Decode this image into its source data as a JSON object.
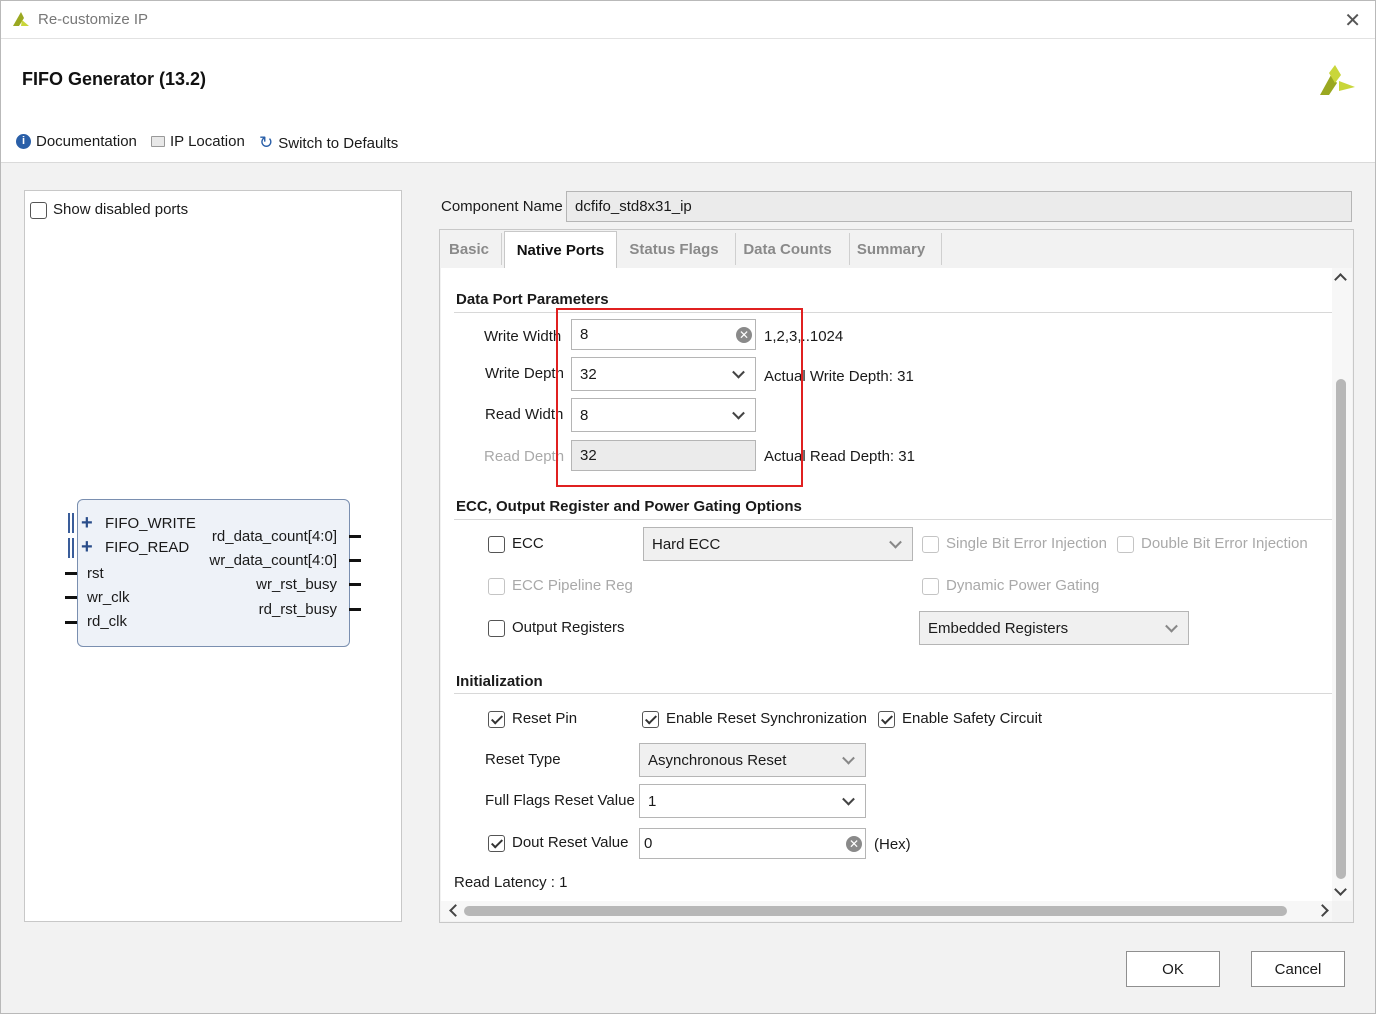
{
  "window": {
    "title": "Re-customize IP"
  },
  "header": {
    "title": "FIFO Generator (13.2)"
  },
  "toolbar": {
    "documentation": "Documentation",
    "ip_location": "IP Location",
    "switch_defaults": "Switch to Defaults"
  },
  "left": {
    "show_disabled_ports": "Show disabled ports",
    "block": {
      "left_ports": [
        "FIFO_WRITE",
        "FIFO_READ",
        "rst",
        "wr_clk",
        "rd_clk"
      ],
      "right_ports": [
        "rd_data_count[4:0]",
        "wr_data_count[4:0]",
        "wr_rst_busy",
        "rd_rst_busy"
      ]
    }
  },
  "component": {
    "label": "Component Name",
    "value": "dcfifo_std8x31_ip"
  },
  "tabs": [
    "Basic",
    "Native Ports",
    "Status Flags",
    "Data Counts",
    "Summary"
  ],
  "data_port": {
    "title": "Data Port Parameters",
    "write_width_label": "Write Width",
    "write_width": "8",
    "write_width_range": "1,2,3,..1024",
    "write_depth_label": "Write Depth",
    "write_depth": "32",
    "actual_write_depth": "Actual Write Depth: 31",
    "read_width_label": "Read Width",
    "read_width": "8",
    "read_depth_label": "Read Depth",
    "read_depth": "32",
    "actual_read_depth": "Actual Read Depth: 31"
  },
  "ecc": {
    "title": "ECC, Output Register and Power Gating Options",
    "ecc_label": "ECC",
    "ecc_type": "Hard ECC",
    "single_bit": "Single Bit Error Injection",
    "double_bit": "Double Bit Error Injection",
    "pipeline": "ECC Pipeline Reg",
    "dynamic_power": "Dynamic Power Gating",
    "output_registers": "Output Registers",
    "register_type": "Embedded Registers"
  },
  "init": {
    "title": "Initialization",
    "reset_pin": "Reset Pin",
    "enable_reset_sync": "Enable Reset Synchronization",
    "enable_safety": "Enable Safety Circuit",
    "reset_type_label": "Reset Type",
    "reset_type": "Asynchronous Reset",
    "full_flags_label": "Full Flags Reset Value",
    "full_flags_value": "1",
    "dout_label": "Dout Reset Value",
    "dout_value": "0",
    "dout_unit": "(Hex)"
  },
  "read_latency": "Read Latency : 1",
  "buttons": {
    "ok": "OK",
    "cancel": "Cancel"
  },
  "colors": {
    "highlight_box": "#e02020",
    "xilinx_logo_a": "#9aa821",
    "xilinx_logo_b": "#c9d63a"
  }
}
